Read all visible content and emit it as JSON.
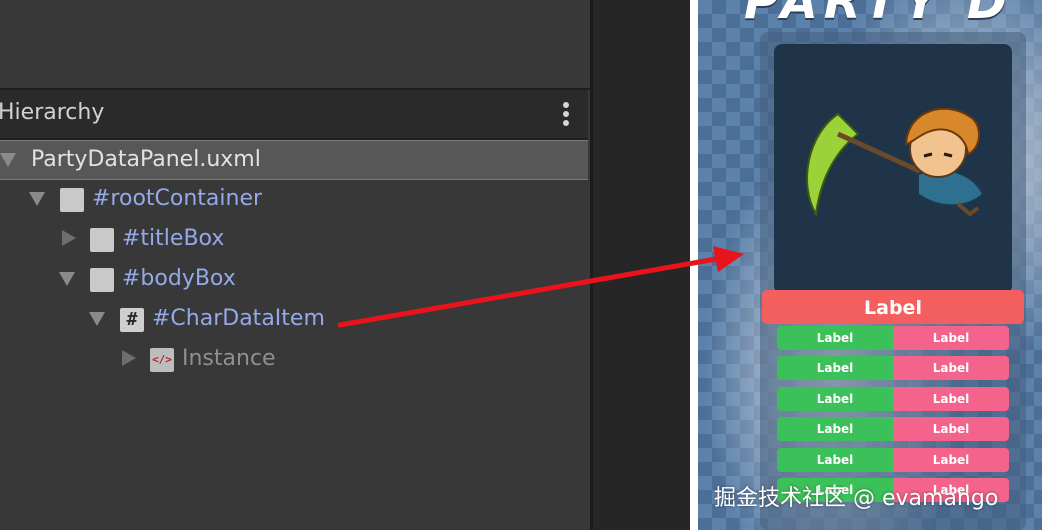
{
  "hierarchy": {
    "title": "Hierarchy",
    "menu_icon": "kebab-menu-icon",
    "items": [
      {
        "label": "PartyDataPanel.uxml",
        "icon": "uxml-asset-icon",
        "expanded": true,
        "selected": true,
        "color": "#e2e2e2"
      },
      {
        "label": "#rootContainer",
        "icon": "visual-element-icon",
        "expanded": true,
        "color": "#93a9e9"
      },
      {
        "label": "#titleBox",
        "icon": "visual-element-icon",
        "expanded": false,
        "color": "#93a9e9"
      },
      {
        "label": "#bodyBox",
        "icon": "visual-element-icon",
        "expanded": true,
        "color": "#93a9e9"
      },
      {
        "label": "#CharDataItem",
        "icon": "template-container-icon",
        "expanded": true,
        "color": "#93a9e9"
      },
      {
        "label": "Instance",
        "icon": "uxml-instance-icon",
        "expanded": false,
        "color": "#8f8f8f"
      }
    ]
  },
  "game": {
    "title": "PARTY D",
    "card": {
      "name_label": "Label",
      "stats": [
        {
          "key": "Label",
          "value": "Label"
        },
        {
          "key": "Label",
          "value": "Label"
        },
        {
          "key": "Label",
          "value": "Label"
        },
        {
          "key": "Label",
          "value": "Label"
        },
        {
          "key": "Label",
          "value": "Label"
        },
        {
          "key": "Label",
          "value": "Label"
        }
      ]
    }
  },
  "watermark": "掘金技术社区 @ evamango",
  "colors": {
    "annotation_arrow": "#e8131b",
    "stat_key_bg": "#3cc05a",
    "stat_value_bg": "#f4638b",
    "name_bar_bg": "#f35f5f"
  }
}
